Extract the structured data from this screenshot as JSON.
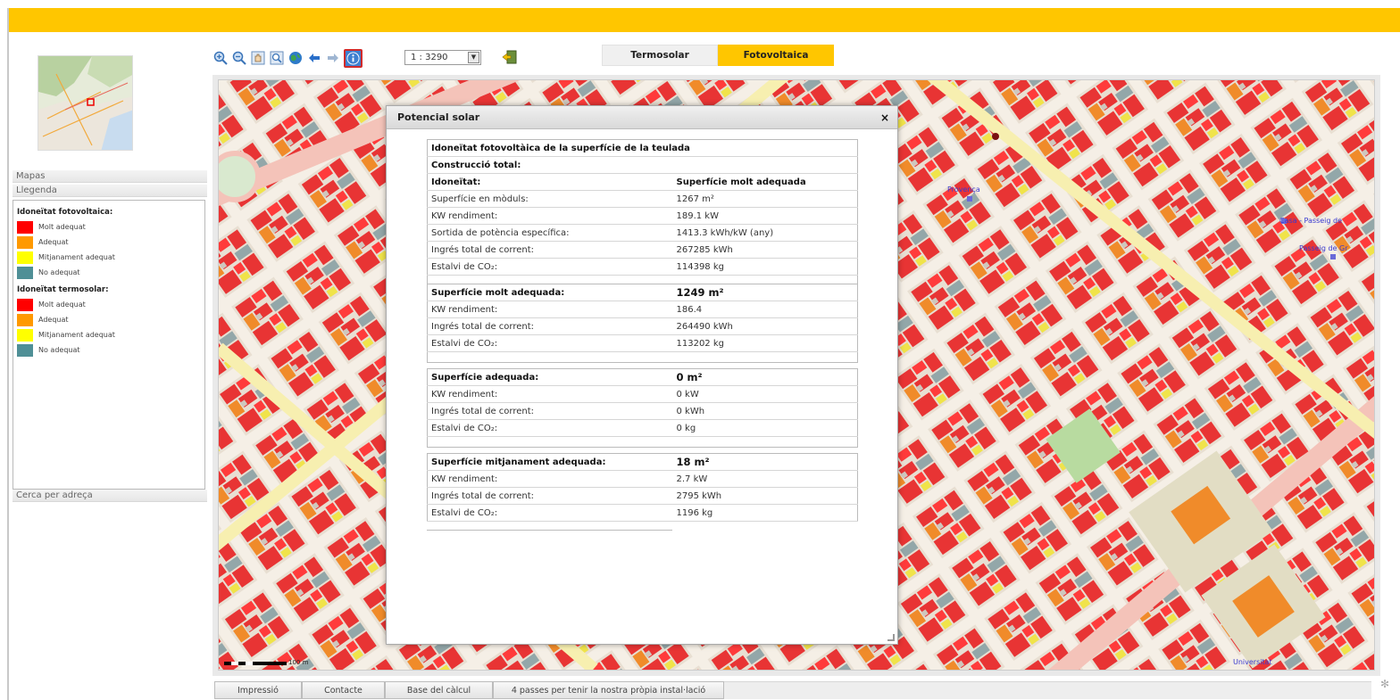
{
  "header": {
    "accent": "#ffc600"
  },
  "left_panel": {
    "mapas_label": "Mapas",
    "llegenda_label": "Llegenda",
    "cerca_label": "Cerca per adreça",
    "legend": {
      "photovoltaic_title": "Idoneïtat fotovoltaica:",
      "photovoltaic_items": [
        {
          "label": "Molt adequat",
          "color": "#ff0000"
        },
        {
          "label": "Adequat",
          "color": "#ff9900"
        },
        {
          "label": "Mitjanament adequat",
          "color": "#ffff00"
        },
        {
          "label": "No adequat",
          "color": "#4f8f96"
        }
      ],
      "thermal_title": "Idoneïtat termosolar:",
      "thermal_items": [
        {
          "label": "Molt adequat",
          "color": "#ff0000"
        },
        {
          "label": "Adequat",
          "color": "#ff9900"
        },
        {
          "label": "Mitjanament adequat",
          "color": "#ffff00"
        },
        {
          "label": "No adequat",
          "color": "#4f8f96"
        }
      ]
    }
  },
  "toolbar": {
    "icons": [
      "zoom-in-icon",
      "zoom-out-icon",
      "pan-icon",
      "zoom-box-icon",
      "globe-icon",
      "back-arrow-icon",
      "forward-arrow-icon",
      "info-icon"
    ],
    "scale_value": "1 : 3290",
    "export_icon": "export-icon"
  },
  "tabs": {
    "termosolar": "Termosolar",
    "fotovoltaica": "Fotovoltaica"
  },
  "map": {
    "labels": [
      "Provença",
      "Casa - Passeig de",
      "Passeig de Gr",
      "Universitat"
    ],
    "scale_label": "100 m"
  },
  "dialog": {
    "title": "Potencial solar",
    "close": "×",
    "table_main": {
      "title": "Idoneïtat fotovoltàica de la superfície de la teulada",
      "construccio": "Construcció total:",
      "idoneitat_label": "Idoneïtat:",
      "idoneitat_value": "Superfície molt adequada",
      "rows": [
        {
          "label": "Superfície en mòduls:",
          "value": "1267 m²"
        },
        {
          "label": "KW rendiment:",
          "value": "189.1 kW"
        },
        {
          "label": "Sortida de potència específica:",
          "value": "1413.3 kWh/kW (any)"
        },
        {
          "label": "Ingrés total de corrent:",
          "value": "267285 kWh"
        },
        {
          "label": "Estalvi de CO₂:",
          "value": "114398 kg"
        }
      ]
    },
    "table_molt": {
      "title": "Superfície molt adequada:",
      "value": "1249 m²",
      "rows": [
        {
          "label": "KW rendiment:",
          "value": "186.4"
        },
        {
          "label": "Ingrés total de corrent:",
          "value": "264490 kWh"
        },
        {
          "label": "Estalvi de CO₂:",
          "value": "113202 kg"
        }
      ]
    },
    "table_adequada": {
      "title": "Superfície adequada:",
      "value": "0 m²",
      "rows": [
        {
          "label": "KW rendiment:",
          "value": "0 kW"
        },
        {
          "label": "Ingrés total de corrent:",
          "value": "0 kWh"
        },
        {
          "label": "Estalvi de CO₂:",
          "value": "0 kg"
        }
      ]
    },
    "table_mitjanament": {
      "title": "Superfície mitjanament adequada:",
      "value": "18 m²",
      "rows": [
        {
          "label": "KW rendiment:",
          "value": "2.7 kW"
        },
        {
          "label": "Ingrés total de corrent:",
          "value": "2795 kWh"
        },
        {
          "label": "Estalvi de CO₂:",
          "value": "1196 kg"
        }
      ]
    }
  },
  "bottom_nav": {
    "items": [
      "Impressió",
      "Contacte",
      "Base del càlcul",
      "4 passes per tenir la nostra pròpia instal·lació"
    ]
  }
}
